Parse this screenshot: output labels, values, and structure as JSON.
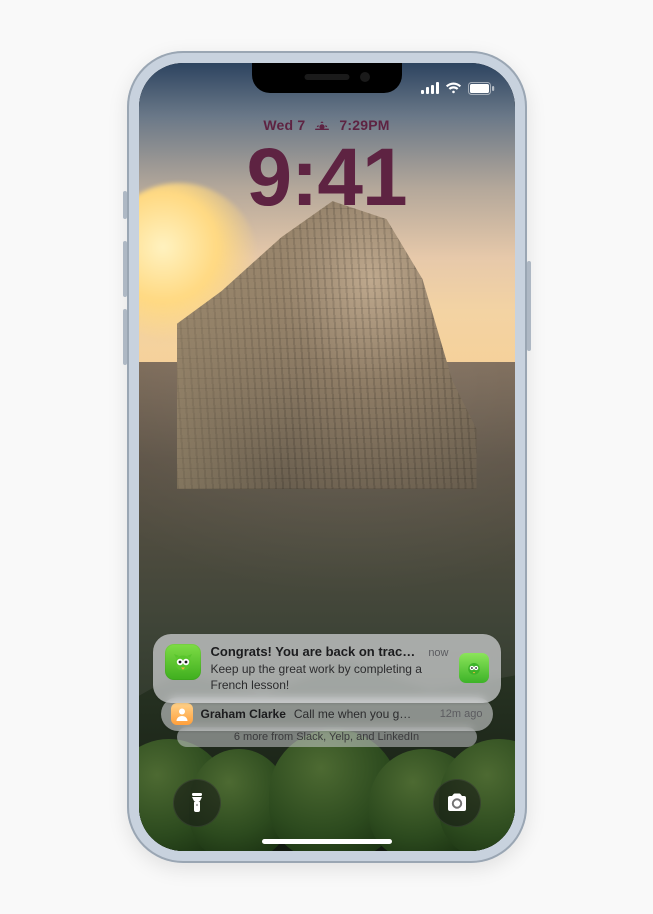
{
  "status": {
    "cellular_bars": 4,
    "wifi_bars": 3,
    "battery_pct": 100
  },
  "lock": {
    "day_label": "Wed 7",
    "sunset_label": "7:29PM",
    "clock": "9:41",
    "text_color": "#5e2342"
  },
  "notifications": [
    {
      "app_icon": "duolingo-icon",
      "title": "Congrats! You are back on track! 👋",
      "body": "Keep up the great work by completing a French lesson!",
      "time": "now",
      "attachment_icon": "duolingo-owl-icon"
    },
    {
      "app_icon": "person-avatar-icon",
      "sender": "Graham Clarke",
      "preview": "Call me when you g…",
      "time": "12m ago"
    }
  ],
  "more_label": "6 more from Slack, Yelp, and LinkedIn",
  "controls": {
    "left": "flashlight",
    "right": "camera"
  }
}
